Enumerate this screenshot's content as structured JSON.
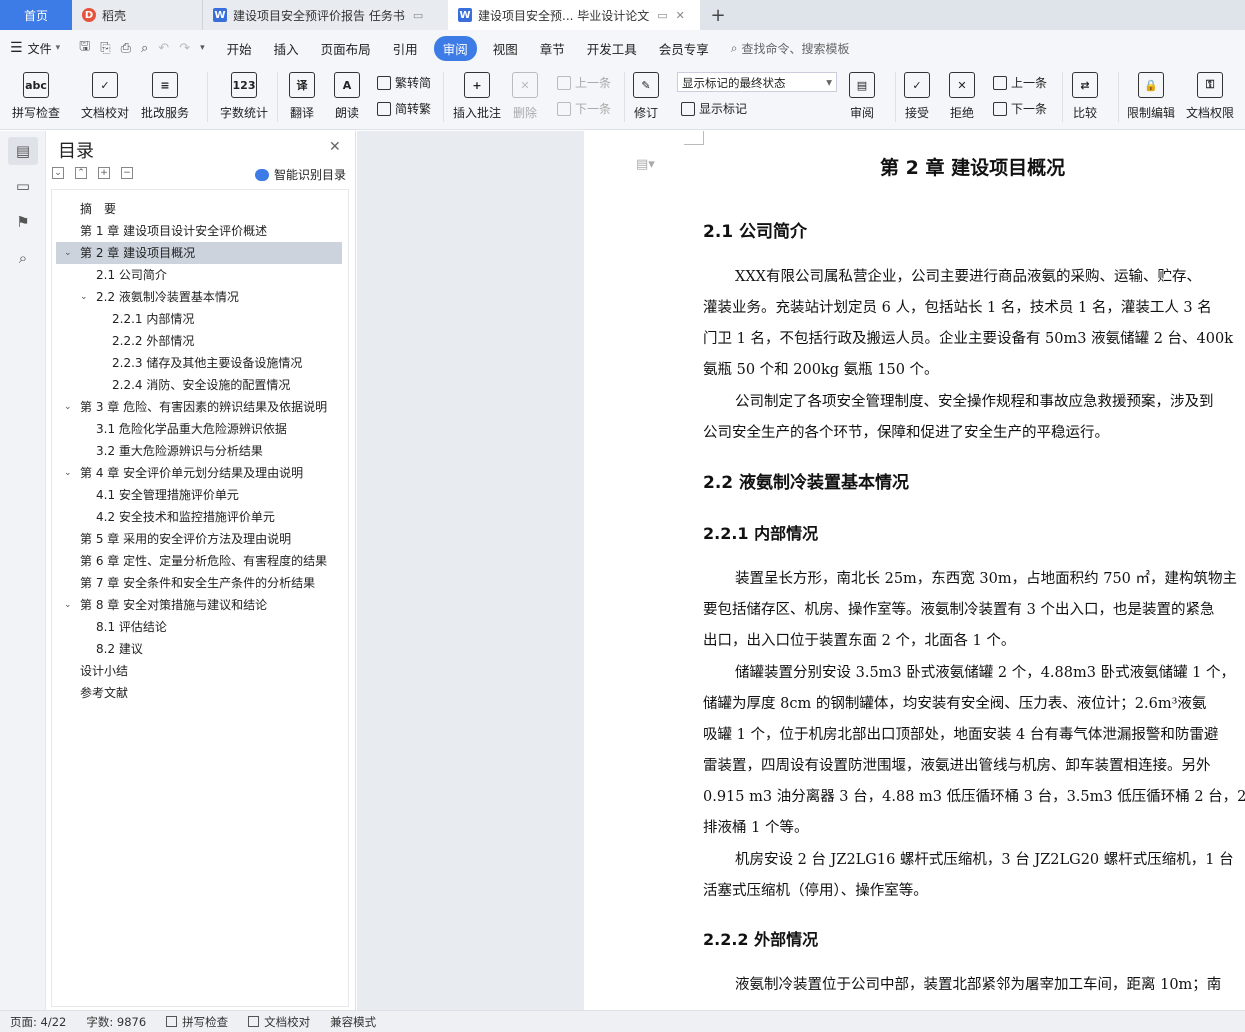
{
  "tabs": [
    {
      "label": "首页"
    },
    {
      "label": "稻壳"
    },
    {
      "label": "建设项目安全预评价报告 任务书"
    },
    {
      "label": "建设项目安全预... 毕业设计论文"
    }
  ],
  "menu": {
    "file": "文件",
    "items": [
      "开始",
      "插入",
      "页面布局",
      "引用",
      "审阅",
      "视图",
      "章节",
      "开发工具",
      "会员专享"
    ],
    "search": "查找命令、搜索模板"
  },
  "toolbar": {
    "spellcheck": "拼写检查",
    "doccheck": "文档校对",
    "batch": "批改服务",
    "wordcount": "字数统计",
    "translate": "翻译",
    "read": "朗读",
    "trad": "繁转简",
    "simp": "简转繁",
    "insert_comment": "插入批注",
    "delete": "删除",
    "prev_comment": "上一条",
    "next_comment": "下一条",
    "revise": "修订",
    "mark_state": "显示标记的最终状态",
    "show_marks": "显示标记",
    "review": "审阅",
    "accept": "接受",
    "reject": "拒绝",
    "prev": "上一条",
    "next": "下一条",
    "compare": "比较",
    "restrict": "限制编辑",
    "permission": "文档权限"
  },
  "toc": {
    "title": "目录",
    "smart": "智能识别目录",
    "items": [
      {
        "label": "摘　要",
        "level": 0,
        "arrow": ""
      },
      {
        "label": "第 1 章  建设项目设计安全评价概述",
        "level": 0,
        "arrow": ""
      },
      {
        "label": "第 2 章  建设项目概况",
        "level": 0,
        "arrow": "v",
        "active": true
      },
      {
        "label": "2.1 公司简介",
        "level": 1,
        "arrow": ""
      },
      {
        "label": "2.2 液氨制冷装置基本情况",
        "level": 1,
        "arrow": "v"
      },
      {
        "label": "2.2.1 内部情况",
        "level": 2,
        "arrow": ""
      },
      {
        "label": "2.2.2 外部情况",
        "level": 2,
        "arrow": ""
      },
      {
        "label": "2.2.3 储存及其他主要设备设施情况",
        "level": 2,
        "arrow": ""
      },
      {
        "label": "2.2.4 消防、安全设施的配置情况",
        "level": 2,
        "arrow": ""
      },
      {
        "label": "第 3 章  危险、有害因素的辨识结果及依据说明",
        "level": 0,
        "arrow": "v"
      },
      {
        "label": "3.1 危险化学品重大危险源辨识依据",
        "level": 1,
        "arrow": ""
      },
      {
        "label": "3.2 重大危险源辨识与分析结果",
        "level": 1,
        "arrow": ""
      },
      {
        "label": "第 4 章  安全评价单元划分结果及理由说明",
        "level": 0,
        "arrow": "v"
      },
      {
        "label": "4.1 安全管理措施评价单元",
        "level": 1,
        "arrow": ""
      },
      {
        "label": "4.2 安全技术和监控措施评价单元",
        "level": 1,
        "arrow": ""
      },
      {
        "label": "第 5 章  采用的安全评价方法及理由说明",
        "level": 0,
        "arrow": ""
      },
      {
        "label": "第 6 章  定性、定量分析危险、有害程度的结果",
        "level": 0,
        "arrow": ""
      },
      {
        "label": "第 7 章  安全条件和安全生产条件的分析结果",
        "level": 0,
        "arrow": ""
      },
      {
        "label": "第 8 章  安全对策措施与建议和结论",
        "level": 0,
        "arrow": "v"
      },
      {
        "label": "8.1 评估结论",
        "level": 1,
        "arrow": ""
      },
      {
        "label": "8.2 建议",
        "level": 1,
        "arrow": ""
      },
      {
        "label": "设计小结",
        "level": 0,
        "arrow": ""
      },
      {
        "label": "参考文献",
        "level": 0,
        "arrow": ""
      }
    ]
  },
  "doc": {
    "chapter": "第 2 章  建设项目概况",
    "h21": "2.1 公司简介",
    "p1": [
      "XXX有限公司属私营企业，公司主要进行商品液氨的采购、运输、贮存、",
      "灌装业务。充装站计划定员 6 人，包括站长 1 名，技术员 1 名，灌装工人 3 名",
      "门卫 1 名，不包括行政及搬运人员。企业主要设备有 50m3 液氨储罐 2 台、400k",
      "氨瓶 50 个和 200kg 氨瓶 150 个。"
    ],
    "p2": [
      "公司制定了各项安全管理制度、安全操作规程和事故应急救援预案，涉及到",
      "公司安全生产的各个环节，保障和促进了安全生产的平稳运行。"
    ],
    "h22": "2.2 液氨制冷装置基本情况",
    "h221": "2.2.1 内部情况",
    "p3": [
      "装置呈长方形，南北长 25m，东西宽 30m，占地面积约 750 ㎡，建构筑物主",
      "要包括储存区、机房、操作室等。液氨制冷装置有 3 个出入口，也是装置的紧急",
      "出口，出入口位于装置东面 2 个，北面各 1 个。"
    ],
    "p4": [
      "储罐装置分别安设 3.5m3 卧式液氨储罐 2 个，4.88m3 卧式液氨储罐 1 个，",
      "储罐为厚度 8cm 的钢制罐体，均安装有安全阀、压力表、液位计；2.6m³液氨",
      "吸罐 1 个，位于机房北部出口顶部处，地面安装 4 台有毒气体泄漏报警和防雷避",
      "雷装置，四周设有设置防泄围堰，液氨进出管线与机房、卸车装置相连接。另外",
      "0.915 m3 油分离器 3 台，4.88 m3 低压循环桶 3 台，3.5m3 低压循环桶 2 台，2.5m",
      "排液桶 1 个等。"
    ],
    "p5": [
      "机房安设 2 台 JZ2LG16 螺杆式压缩机，3 台 JZ2LG20 螺杆式压缩机，1 台",
      "活塞式压缩机（停用）、操作室等。"
    ],
    "h222": "2.2.2 外部情况",
    "p6": [
      "液氨制冷装置位于公司中部，装置北部紧邻为屠宰加工车间，距离 10m；南"
    ]
  },
  "status": {
    "page": "页面: 4/22",
    "words": "字数: 9876",
    "spell": "拼写检查",
    "check": "文档校对",
    "compat": "兼容模式"
  }
}
